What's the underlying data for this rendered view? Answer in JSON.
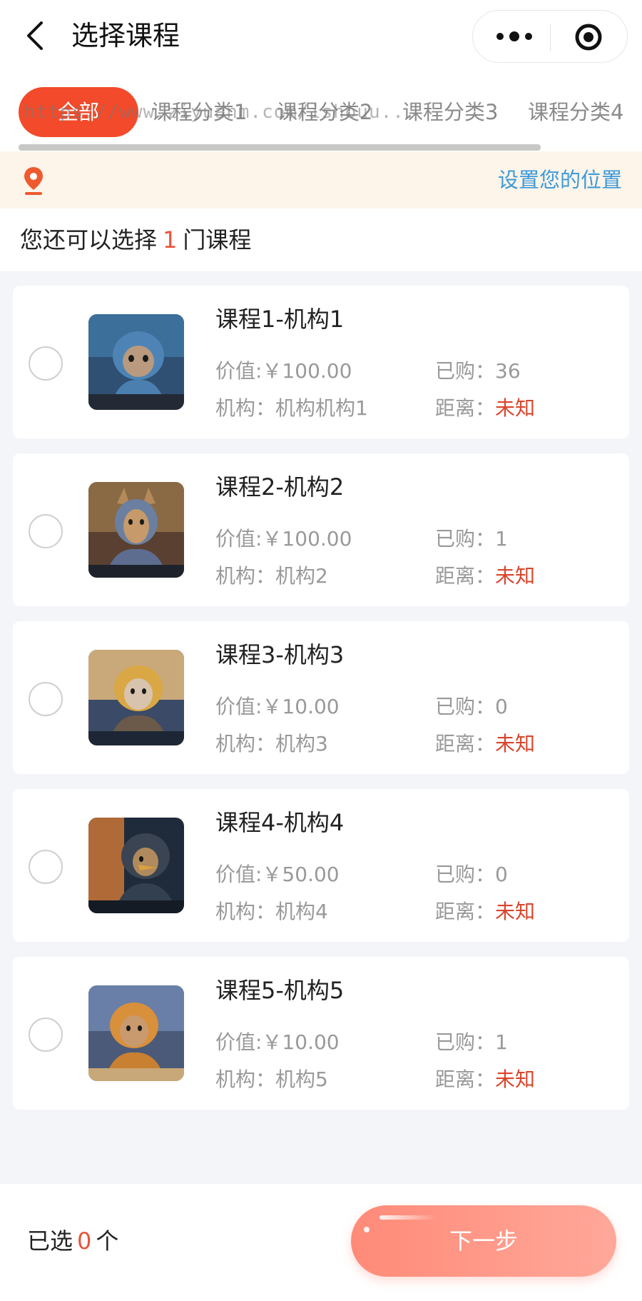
{
  "nav": {
    "title": "选择课程"
  },
  "tabs": [
    {
      "label": "全部",
      "active": true
    },
    {
      "label": "课程分类1"
    },
    {
      "label": "课程分类2"
    },
    {
      "label": "课程分类3"
    },
    {
      "label": "课程分类4"
    }
  ],
  "watermark": "https://www.ziyuanm.com/ishouu...",
  "location": {
    "link": "设置您的位置",
    "icon": "location-pin-icon"
  },
  "hint": {
    "prefix": "您还可以选择",
    "count": "1",
    "suffix": "门课程"
  },
  "courses": [
    {
      "title": "课程1-机构1",
      "price": "价值:￥100.00",
      "org": "机构：机构机构1",
      "sold_label": "已购：",
      "sold": "36",
      "dist_label": "距离：",
      "dist": "未知"
    },
    {
      "title": "课程2-机构2",
      "price": "价值:￥100.00",
      "org": "机构：机构2",
      "sold_label": "已购：",
      "sold": "1",
      "dist_label": "距离：",
      "dist": "未知"
    },
    {
      "title": "课程3-机构3",
      "price": "价值:￥10.00",
      "org": "机构：机构3",
      "sold_label": "已购：",
      "sold": "0",
      "dist_label": "距离：",
      "dist": "未知"
    },
    {
      "title": "课程4-机构4",
      "price": "价值:￥50.00",
      "org": "机构：机构4",
      "sold_label": "已购：",
      "sold": "0",
      "dist_label": "距离：",
      "dist": "未知"
    },
    {
      "title": "课程5-机构5",
      "price": "价值:￥10.00",
      "org": "机构：机构5",
      "sold_label": "已购：",
      "sold": "1",
      "dist_label": "距离：",
      "dist": "未知"
    }
  ],
  "footer": {
    "prefix": "已选",
    "count": "0",
    "suffix": "个",
    "next_label": "下一步"
  },
  "colors": {
    "accent": "#f24a2a",
    "price_red": "#d9452b",
    "link_blue": "#3d9ad8",
    "button": "#ff8a78"
  }
}
